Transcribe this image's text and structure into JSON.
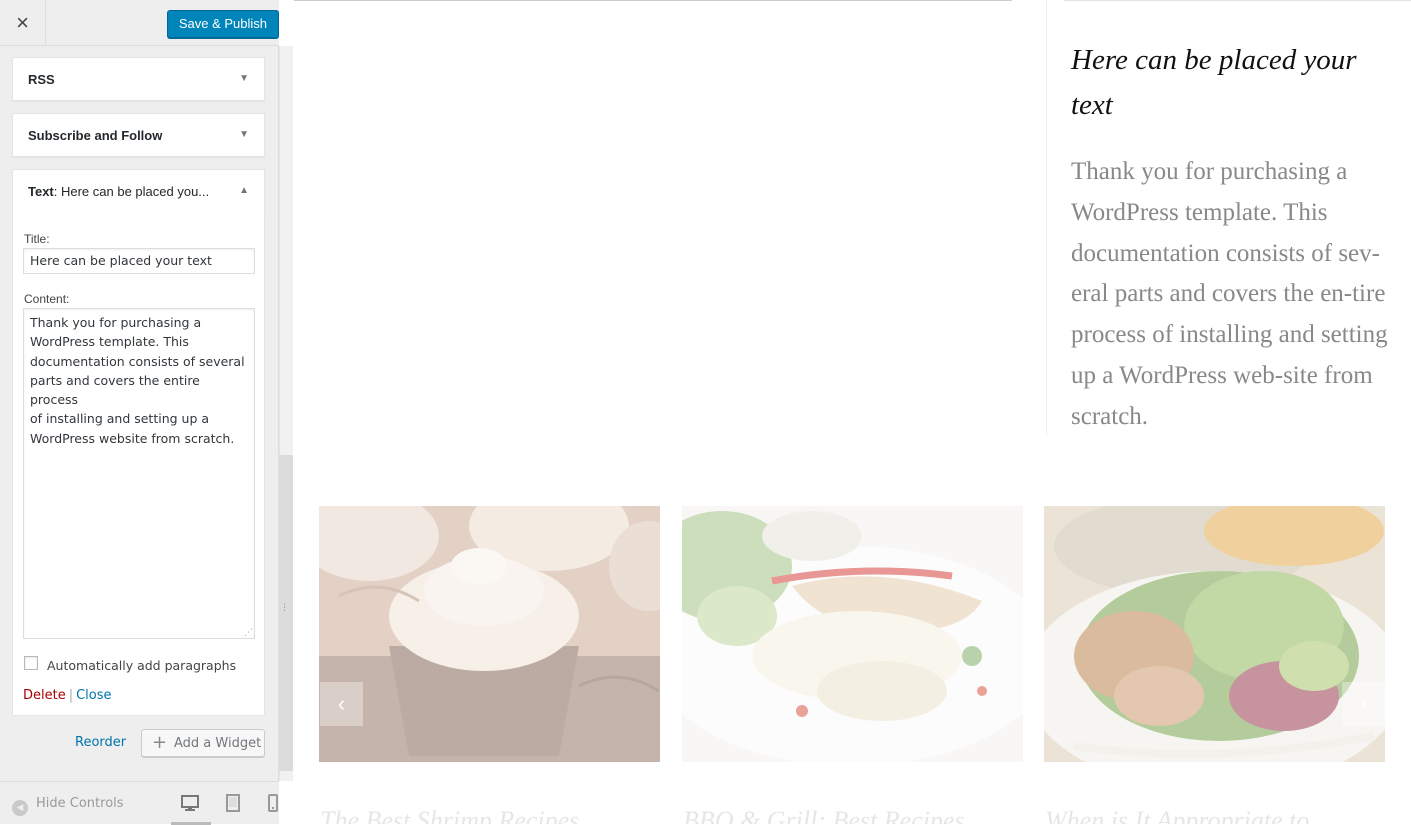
{
  "header": {
    "close_label": "×",
    "save_label": "Save & Publish"
  },
  "widgets": {
    "rss": {
      "title": "RSS",
      "arrow": "▼"
    },
    "subscribe": {
      "title": "Subscribe and Follow",
      "arrow": "▼"
    },
    "text": {
      "title_prefix": "Text",
      "title_suffix": ": Here can be placed you...",
      "arrow": "▲",
      "title_label": "Title:",
      "title_value": "Here can be placed your text",
      "content_label": "Content:",
      "content_value": "Thank you for purchasing a\nWordPress template. This\ndocumentation consists of several\nparts and covers the entire process\nof installing and setting up a\nWordPress website from scratch.",
      "auto_paragraphs_label": "Automatically add paragraphs",
      "auto_paragraphs_checked": false,
      "delete_label": "Delete",
      "separator": "|",
      "close_label": "Close"
    }
  },
  "actions": {
    "reorder_label": "Reorder",
    "add_widget_label": "Add a Widget",
    "add_widget_icon": "+"
  },
  "footer": {
    "hide_controls_label": "Hide Controls",
    "hide_icon": "◀",
    "devices": [
      "desktop-icon",
      "tablet-icon",
      "mobile-icon"
    ],
    "active_device": "desktop"
  },
  "preview": {
    "widget_title": "Here can be placed your text",
    "widget_text": "Thank you for purchasing a WordPress template. This documentation consists of sev-eral parts and covers the en-tire process of installing and setting up a WordPress web-site from scratch.",
    "slider_prev": "‹",
    "slider_next": "›",
    "posts": [
      {
        "title": "The Best Shrimp Recipes"
      },
      {
        "title": "BBQ & Grill: Best Recipes"
      },
      {
        "title": "When is It Appropriate to"
      }
    ],
    "images": [
      "cupcakes-photo",
      "grilled-fish-plate-photo",
      "salad-plate-photo"
    ]
  },
  "colors": {
    "primary": "#0085ba",
    "link": "#0073aa",
    "delete": "#aa0000",
    "panel_bg": "#eeeeee"
  }
}
